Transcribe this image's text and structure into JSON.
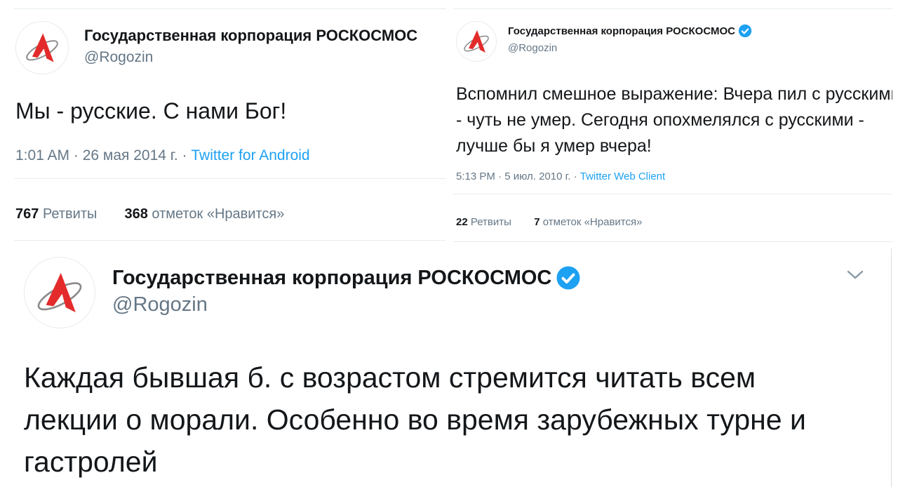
{
  "colors": {
    "accent": "#1da1f2",
    "text": "#14171a",
    "muted": "#657786",
    "divider": "#e6ecf0",
    "logo_red": "#e32b2b",
    "logo_grey": "#8a8a8a"
  },
  "tweets": [
    {
      "author_name": "Государственная корпорация РОСКОСМОС",
      "handle": "@Rogozin",
      "verified": false,
      "text": "Мы - русские. С нами Бог!",
      "time": "1:01 AM · 26 мая 2014 г. · ",
      "source": "Twitter for Android",
      "retweets_count": "767",
      "retweets_label": "Ретвиты",
      "likes_count": "368",
      "likes_label": "отметок «Нравится»"
    },
    {
      "author_name": "Государственная корпорация РОСКОСМОС",
      "handle": "@Rogozin",
      "verified": true,
      "text": "Вспомнил смешное выражение: Вчера пил с русскими - чуть не умер. Сегодня опохмелялся с русскими - лучше бы я умер вчера!",
      "time": "5:13 PM · 5 июл. 2010 г. · ",
      "source": "Twitter Web Client",
      "retweets_count": "22",
      "retweets_label": "Ретвиты",
      "likes_count": "7",
      "likes_label": "отметок «Нравится»"
    },
    {
      "author_name": "Государственная корпорация РОСКОСМОС",
      "handle": "@Rogozin",
      "verified": true,
      "text": "Каждая бывшая б. с возрастом стремится читать всем лекции о морали. Особенно во время зарубежных турне и гастролей",
      "menu_icon": "chevron-down-icon"
    }
  ]
}
